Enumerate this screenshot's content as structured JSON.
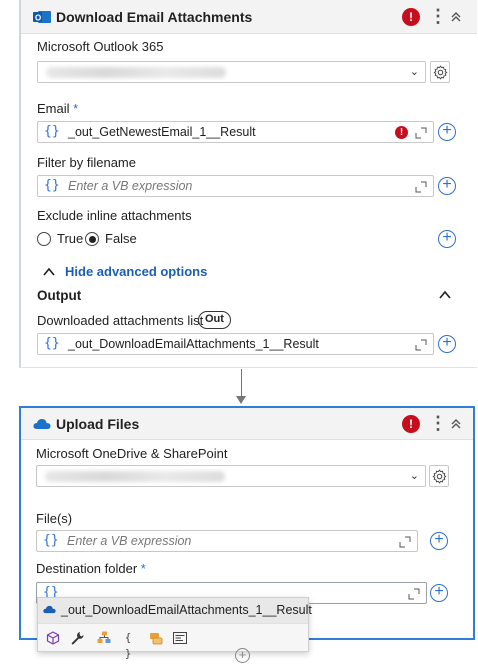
{
  "card1": {
    "title": "Download Email Attachments",
    "connection_label": "Microsoft Outlook 365",
    "email_label": "Email",
    "required_mark": "*",
    "email_value": "_out_GetNewestEmail_1__Result",
    "filter_label": "Filter by filename",
    "filter_placeholder": "Enter a VB expression",
    "exclude_label": "Exclude inline attachments",
    "radio_true": "True",
    "radio_false": "False",
    "selected_radio": "False",
    "hide_advanced": "Hide advanced options",
    "output_title": "Output",
    "downloaded_label": "Downloaded attachments list",
    "out_badge": "Out",
    "downloaded_value": "_out_DownloadEmailAttachments_1__Result"
  },
  "card2": {
    "title": "Upload Files",
    "connection_label": "Microsoft OneDrive & SharePoint",
    "files_label": "File(s)",
    "files_placeholder": "Enter a VB expression",
    "dest_label": "Destination folder",
    "required_mark": "*"
  },
  "autocomplete": {
    "suggestion": "_out_DownloadEmailAttachments_1__Result",
    "toolbar_icons": [
      "cube-icon",
      "wrench-icon",
      "tree-icon",
      "braces-icon",
      "key-icon",
      "list-icon"
    ],
    "braces_text": "{ }"
  },
  "icons": {
    "error": "!",
    "braces": "{}",
    "kebab": "⋮",
    "plus": "+"
  },
  "colors": {
    "accent": "#2f6fd0",
    "error": "#c50f1f",
    "selected_border": "#2f7ed8",
    "link": "#1a5fb4"
  }
}
